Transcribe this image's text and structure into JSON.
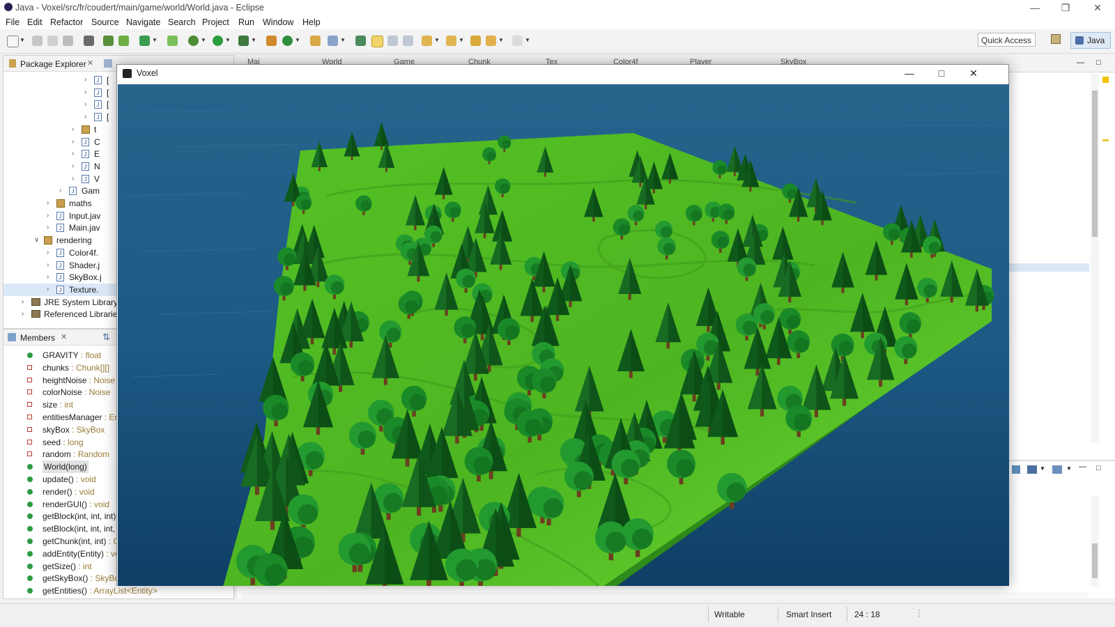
{
  "window_title": "Java - Voxel/src/fr/coudert/main/game/world/World.java - Eclipse",
  "menu": [
    "File",
    "Edit",
    "Refactor",
    "Source",
    "Navigate",
    "Search",
    "Project",
    "Run",
    "Window",
    "Help"
  ],
  "toolbar": {
    "quick_access": "Quick Access",
    "perspective": "Java"
  },
  "package_explorer": {
    "title": "Package Explorer",
    "items": [
      {
        "label": "[",
        "indent": 5,
        "icon": "java-file-icon"
      },
      {
        "label": "[",
        "indent": 5,
        "icon": "java-file-icon"
      },
      {
        "label": "[",
        "indent": 5,
        "icon": "java-file-icon"
      },
      {
        "label": "[",
        "indent": 5,
        "icon": "java-file-icon"
      },
      {
        "label": "t",
        "indent": 4,
        "icon": "package-icon"
      },
      {
        "label": "C",
        "indent": 4,
        "icon": "java-file-icon"
      },
      {
        "label": "E",
        "indent": 4,
        "icon": "java-file-icon"
      },
      {
        "label": "N",
        "indent": 4,
        "icon": "java-file-icon"
      },
      {
        "label": "V",
        "indent": 4,
        "icon": "java-file-icon"
      },
      {
        "label": "Gam",
        "indent": 3,
        "icon": "java-file-icon"
      },
      {
        "label": "maths",
        "indent": 2,
        "icon": "package-icon"
      },
      {
        "label": "Input.jav",
        "indent": 2,
        "icon": "java-file-icon"
      },
      {
        "label": "Main.jav",
        "indent": 2,
        "icon": "java-file-icon"
      },
      {
        "label": "rendering",
        "indent": 1,
        "icon": "package-icon",
        "expanded": true
      },
      {
        "label": "Color4f.",
        "indent": 2,
        "icon": "java-file-icon"
      },
      {
        "label": "Shader.j",
        "indent": 2,
        "icon": "java-file-icon"
      },
      {
        "label": "SkyBox.j",
        "indent": 2,
        "icon": "java-file-icon"
      },
      {
        "label": "Texture.",
        "indent": 2,
        "icon": "java-file-icon",
        "selected": true
      },
      {
        "label": "JRE System Library",
        "indent": 0,
        "icon": "library-icon"
      },
      {
        "label": "Referenced Librarie",
        "indent": 0,
        "icon": "library-icon"
      }
    ]
  },
  "members": {
    "title": "Members",
    "items": [
      {
        "name": "GRAVITY",
        "type": " : float",
        "kind": "static-field"
      },
      {
        "name": "chunks",
        "type": " : Chunk[][]",
        "kind": "private-field"
      },
      {
        "name": "heightNoise",
        "type": " : Noise",
        "kind": "private-field"
      },
      {
        "name": "colorNoise",
        "type": " : Noise",
        "kind": "private-field"
      },
      {
        "name": "size",
        "type": " : int",
        "kind": "private-field"
      },
      {
        "name": "entitiesManager",
        "type": " : En",
        "kind": "private-field"
      },
      {
        "name": "skyBox",
        "type": " : SkyBox",
        "kind": "private-field"
      },
      {
        "name": "seed",
        "type": " : long",
        "kind": "private-field"
      },
      {
        "name": "random",
        "type": " : Random",
        "kind": "private-field"
      },
      {
        "name": "World(long)",
        "type": "",
        "kind": "constructor",
        "selected": true
      },
      {
        "name": "update()",
        "type": " : void",
        "kind": "method"
      },
      {
        "name": "render()",
        "type": " : void",
        "kind": "method"
      },
      {
        "name": "renderGUI()",
        "type": " : void",
        "kind": "method"
      },
      {
        "name": "getBlock(int, int, int)",
        "type": "",
        "kind": "method"
      },
      {
        "name": "setBlock(int, int, int,",
        "type": "",
        "kind": "method"
      },
      {
        "name": "getChunk(int, int)",
        "type": " : C",
        "kind": "method"
      },
      {
        "name": "addEntity(Entity)",
        "type": " : vo",
        "kind": "method"
      },
      {
        "name": "getSize()",
        "type": " : int",
        "kind": "method"
      },
      {
        "name": "getSkyBox()",
        "type": " : SkyBox",
        "kind": "method"
      },
      {
        "name": "getEntities()",
        "type": " : ArrayList<Entity>",
        "kind": "method"
      }
    ]
  },
  "editor_tabs": [
    "Mai",
    "World",
    "Game",
    "Chunk",
    "Tex",
    "Color4f",
    "Player",
    "SkyBox"
  ],
  "voxel_window": {
    "title": "Voxel"
  },
  "status": {
    "writable": "Writable",
    "insert_mode": "Smart Insert",
    "position": "24 : 18"
  },
  "colors": {
    "water": "#1b5a86",
    "grass_light": "#5fd02a",
    "grass_dark": "#3f9a1c",
    "tree_dark": "#0f5a1a",
    "tree_mid": "#1a8a28",
    "selection": "#dbe8f8"
  }
}
